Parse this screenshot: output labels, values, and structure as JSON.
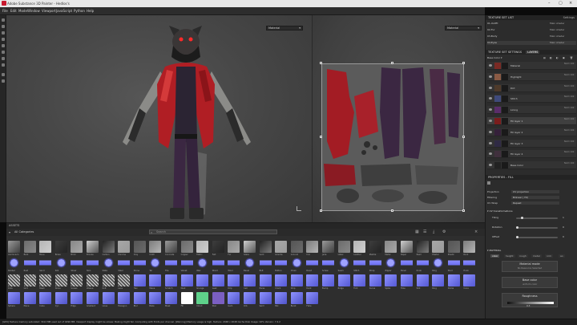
{
  "window": {
    "title": "Adobe Substance 3D Painter - Hedlos's"
  },
  "menu": {
    "items": [
      "File",
      "Edit",
      "Mode",
      "Window",
      "Viewport",
      "JavaScript",
      "Python",
      "Help"
    ]
  },
  "viewport": {
    "view_3d_mode": "Material",
    "view_2d_mode": "Material"
  },
  "shelf": {
    "title": "ASSETS",
    "filter_label": "All Categories",
    "search_placeholder": "Search",
    "labels_row1": [
      "Aluminium",
      "Bark",
      "Bone",
      "Brass",
      "Brick",
      "Bronze",
      "Carbon",
      "Chrome",
      "Clay",
      "Cloth",
      "Concrete",
      "Copper",
      "Fabric",
      "Felt",
      "Fur",
      "Glass",
      "Gold",
      "Granite",
      "Ground",
      "Iron",
      "Jade",
      "Latex",
      "Leather",
      "Marble",
      "Metal",
      "Paper",
      "Pearl",
      "Plaster",
      "Plastic",
      "Rock"
    ],
    "labels_row2": [
      "Rubber",
      "Rust",
      "Sand",
      "Silk",
      "Silver",
      "Skin",
      "Slate",
      "Steel",
      "Stone",
      "Tar",
      "Tile",
      "Velvet",
      "Wax",
      "Wood",
      "Wool",
      "Bevel",
      "Bolt",
      "Button",
      "Chain",
      "Rivet",
      "Screw",
      "Seam",
      "Stitch",
      "Strap",
      "Zipper",
      "Panel",
      "Knob",
      "Ring",
      "Stud",
      "Hook"
    ],
    "labels_row3": [
      "Dots",
      "Grid",
      "Mesh",
      "Noise",
      "Scales",
      "Weave",
      "Knit",
      "Lace",
      "Hex",
      "Wave",
      "Scratch",
      "Dust",
      "Grunge",
      "Leak",
      "Drip",
      "Cell",
      "Pores",
      "Crack",
      "Chip",
      "Dent",
      "Bump",
      "Ridge",
      "Fold",
      "Curve",
      "Spike",
      "Hole",
      "Slot",
      "Ring",
      "Dome",
      "Cone"
    ],
    "labels_row4": [
      "Sphere",
      "Plane",
      "Cube",
      "Cyl.",
      "Edge",
      "Gradient",
      "Lines",
      "Hexagon",
      "Blur",
      "Bake",
      "Mask",
      "Fill",
      "Cloud",
      "Star",
      "Gem",
      "Orb",
      "Swirl",
      "Mix",
      "Burst",
      "Flare"
    ]
  },
  "texture_set_list": {
    "title": "TEXTURE SET LIST",
    "settings_button": "Settings",
    "items": [
      {
        "name": "01-Outfit",
        "shader": "Main shader"
      },
      {
        "name": "02-Fur",
        "shader": "Main shader"
      },
      {
        "name": "03-Body",
        "shader": "Main shader"
      },
      {
        "name": "04-Eyes",
        "shader": "Main shader"
      }
    ]
  },
  "layers": {
    "tab_settings": "TEXTURE SET SETTINGS",
    "tab_layers": "LAYERS",
    "channel": "Base Color",
    "items": [
      {
        "name": "Material",
        "mode": "Norm 100",
        "color": "#7a2a24"
      },
      {
        "name": "Highlight",
        "mode": "Norm 100",
        "color": "#8a5a44"
      },
      {
        "name": "Dirt",
        "mode": "Norm 100",
        "color": "#4e3a2a"
      },
      {
        "name": "Stitch",
        "mode": "Norm 100",
        "color": "#3f4a7a"
      },
      {
        "name": "Lining",
        "mode": "Norm 100",
        "color": "#5a2d6a"
      },
      {
        "name": "Fill layer 1",
        "mode": "Norm 100",
        "color": "#7a1d1d"
      },
      {
        "name": "Fill layer 2",
        "mode": "Norm 100",
        "color": "#35203a"
      },
      {
        "name": "Fill layer 3",
        "mode": "Norm 100",
        "color": "#2f2a44"
      },
      {
        "name": "Fill layer 4",
        "mode": "Norm 100",
        "color": "#40303d"
      },
      {
        "name": "Base Color",
        "mode": "Norm 100",
        "color": "#222222"
      }
    ]
  },
  "properties": {
    "title": "PROPERTIES - FILL",
    "projection_label": "Projection",
    "projection_value": "UV projection",
    "filtering_label": "Filtering",
    "filtering_value": "Bilinear | HQ",
    "wrap_label": "UV Wrap",
    "wrap_value": "Repeat",
    "transform_label": "UV transformations",
    "tiling_label": "Tiling",
    "rotation_label": "Rotation",
    "offset_label": "Offset",
    "material_title": "MATERIAL",
    "channel_tabs": [
      "color",
      "height",
      "rough",
      "metal",
      "nrm",
      "ao"
    ],
    "material_mode_title": "Material mode",
    "material_mode_value": "No Resource Selected",
    "base_color_label": "Base color",
    "base_color_value": "uniform color",
    "roughness_label": "Roughness",
    "roughness_value": "0.3",
    "tiling_value": "1",
    "rotation_value": "0",
    "offset_value": "0"
  },
  "status": {
    "text": "[GPU] Texture memory saturated: 3412 MB used out of 4096 MB. Viewport display might be slower. Baking might fail. Computing with 8 bits per channel. [Warning] Memory usage is high.   Texture: 2048 x 2048   Cache Disk Usage: 92%   Version: 7.4.2"
  },
  "colors": {
    "accent": "#f0b000",
    "jacket": "#b01e24",
    "uv_red": "#a31c24",
    "uv_purple": "#3b2742"
  }
}
